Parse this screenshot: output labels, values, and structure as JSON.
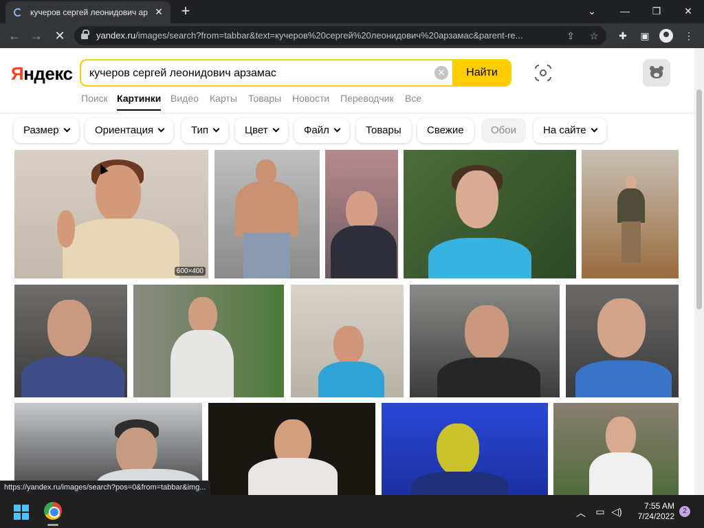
{
  "browser": {
    "tab_title": "кучеров сергей леонидович ар",
    "tab_close": "✕",
    "new_tab": "+",
    "url_host": "yandex.ru",
    "url_path": "/images/search?from=tabbar&text=кучеров%20сергей%20леонидович%20арзамас&parent-re...",
    "status_url": "https://yandex.ru/images/search?pos=0&from=tabbar&img..."
  },
  "yandex": {
    "logo_first": "Я",
    "logo_rest": "ндекс",
    "query": "кучеров сергей леонидович арзамас",
    "search_button": "Найти",
    "clear_icon": "✕"
  },
  "nav_tabs": [
    "Поиск",
    "Картинки",
    "Видео",
    "Карты",
    "Товары",
    "Новости",
    "Переводчик",
    "Все"
  ],
  "active_tab": "Картинки",
  "filters": {
    "size": "Размер",
    "orientation": "Ориентация",
    "type": "Тип",
    "color": "Цвет",
    "file": "Файл",
    "goods": "Товары",
    "fresh": "Свежие",
    "wallpapers": "Обои",
    "on_site": "На сайте"
  },
  "results": {
    "first_size_badge": "600×400"
  },
  "taskbar": {
    "time": "7:55 AM",
    "date": "7/24/2022",
    "notification_count": "2"
  },
  "icons": {
    "back": "arrow-left-icon",
    "forward": "arrow-right-icon",
    "reload": "close-icon",
    "lock": "lock-icon",
    "share": "share-icon",
    "star": "star-icon",
    "extensions": "puzzle-icon",
    "sidepanel": "sidepanel-icon",
    "profile": "profile-icon",
    "menu": "kebab-menu-icon",
    "lens": "camera-search-icon",
    "avatar": "bear-avatar-icon"
  }
}
